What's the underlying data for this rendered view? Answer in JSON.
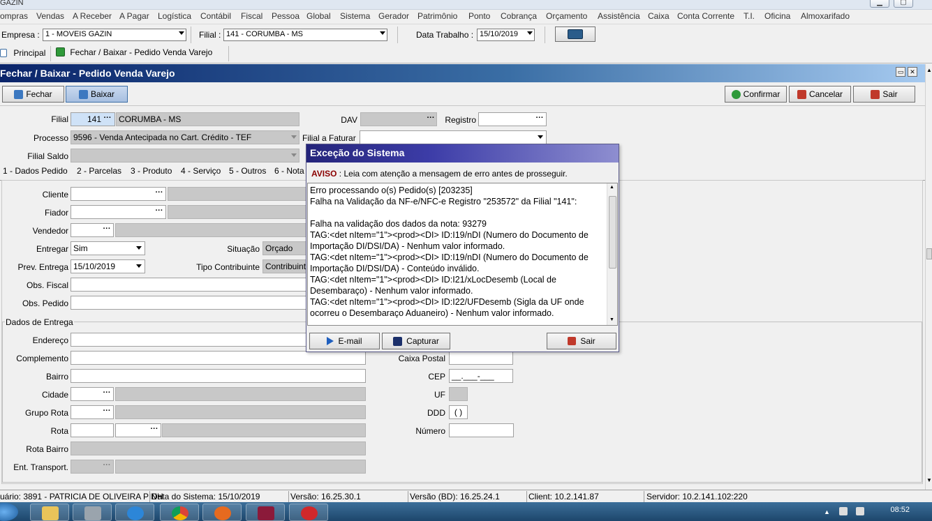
{
  "window": {
    "title": "GAZIN"
  },
  "menu": [
    "ompras",
    "Vendas",
    "A Receber",
    "A Pagar",
    "Logística",
    "Contábil",
    "Fiscal",
    "Pessoa",
    "Global",
    "Sistema",
    "Gerador",
    "Patrimônio",
    "Ponto",
    "Cobrança",
    "Orçamento",
    "Assistência",
    "Caixa",
    "Conta Corrente",
    "T.I.",
    "Oficina",
    "Almoxarifado"
  ],
  "context": {
    "empresa_label": "Empresa :",
    "empresa_value": "1 - MOVEIS GAZIN",
    "filial_label": "Filial :",
    "filial_value": "141 - CORUMBA  - MS",
    "data_label": "Data Trabalho :",
    "data_value": "15/10/2019"
  },
  "tabs": {
    "principal": "Principal",
    "current": "Fechar / Baixar - Pedido Venda Varejo"
  },
  "form": {
    "title": "Fechar / Baixar - Pedido Venda Varejo",
    "toolbar": {
      "fechar": "Fechar",
      "baixar": "Baixar",
      "confirmar": "Confirmar",
      "cancelar": "Cancelar",
      "sair": "Sair"
    },
    "filial_label": "Filial",
    "filial_code": "141",
    "filial_name": "CORUMBA  - MS",
    "dav_label": "DAV",
    "registro_label": "Registro",
    "processo_label": "Processo",
    "processo_value": "9596 - Venda Antecipada no Cart. Crédito - TEF",
    "filial_faturar_label": "Filial a Faturar",
    "filial_saldo_label": "Filial Saldo",
    "inner_tabs": [
      "1 - Dados Pedido",
      "2 - Parcelas",
      "3 - Produto",
      "4 - Serviço",
      "5 - Outros",
      "6 - Nota"
    ],
    "cliente_label": "Cliente",
    "fiador_label": "Fiador",
    "vendedor_label": "Vendedor",
    "entregar_label": "Entregar",
    "entregar_value": "Sim",
    "situacao_label": "Situação",
    "situacao_value": "Orçado",
    "prev_entrega_label": "Prev. Entrega",
    "prev_entrega_value": "15/10/2019",
    "tipo_contribuinte_label": "Tipo Contribuinte",
    "tipo_contribuinte_value": "Contribuint",
    "obs_fiscal_label": "Obs. Fiscal",
    "obs_pedido_label": "Obs. Pedido",
    "entrega_group": "Dados de Entrega",
    "endereco_label": "Endereço",
    "complemento_label": "Complemento",
    "bairro_label": "Bairro",
    "cidade_label": "Cidade",
    "grupo_rota_label": "Grupo Rota",
    "rota_label": "Rota",
    "rota_bairro_label": "Rota Bairro",
    "ent_transport_label": "Ent. Transport.",
    "caixa_postal_label": "Caixa Postal",
    "cep_label": "CEP",
    "cep_value": "__.___-___",
    "uf_label": "UF",
    "ddd_label": "DDD",
    "ddd_value": "(  )",
    "numero_label": "Número"
  },
  "dialog": {
    "title": "Exceção do Sistema",
    "aviso_label": "AVISO",
    "aviso_text": ": Leia com atenção a mensagem de erro antes de prosseguir.",
    "lines": [
      "Erro processando o(s) Pedido(s) [203235]",
      "Falha na Validação da NF-e/NFC-e Registro \"253572\" da Filial \"141\":",
      "",
      "Falha na validação dos dados da nota: 93279",
      "TAG:<det nItem=\"1\"><prod><DI> ID:I19/nDI (Numero do Documento de",
      "Importação DI/DSI/DA) - Nenhum valor informado.",
      "TAG:<det nItem=\"1\"><prod><DI> ID:I19/nDI (Numero do Documento de",
      "Importação DI/DSI/DA) - Conteúdo inválido.",
      "TAG:<det nItem=\"1\"><prod><DI> ID:I21/xLocDesemb (Local de",
      "Desembaraço) - Nenhum valor informado.",
      "TAG:<det nItem=\"1\"><prod><DI> ID:I22/UFDesemb (Sigla da UF onde",
      "ocorreu o Desembaraço Aduaneiro) - Nenhum valor informado."
    ],
    "email": "E-mail",
    "capturar": "Capturar",
    "sair": "Sair"
  },
  "status": {
    "usuario": "uário: 3891 - PATRICIA DE OLIVEIRA PINH",
    "data_sistema": "Data do Sistema: 15/10/2019",
    "versao": "Versão: 16.25.30.1",
    "versao_bd": "Versão (BD): 16.25.24.1",
    "client": "Client: 10.2.141.87",
    "servidor": "Servidor: 10.2.141.102:220"
  },
  "taskbar": {
    "time": "08:52"
  },
  "colors": {
    "form_header": "#0a246a",
    "dialog_header": "#24247a",
    "aviso": "#8b0000",
    "field_gray": "#c8c8c8",
    "field_blue": "#cfe2f7"
  }
}
